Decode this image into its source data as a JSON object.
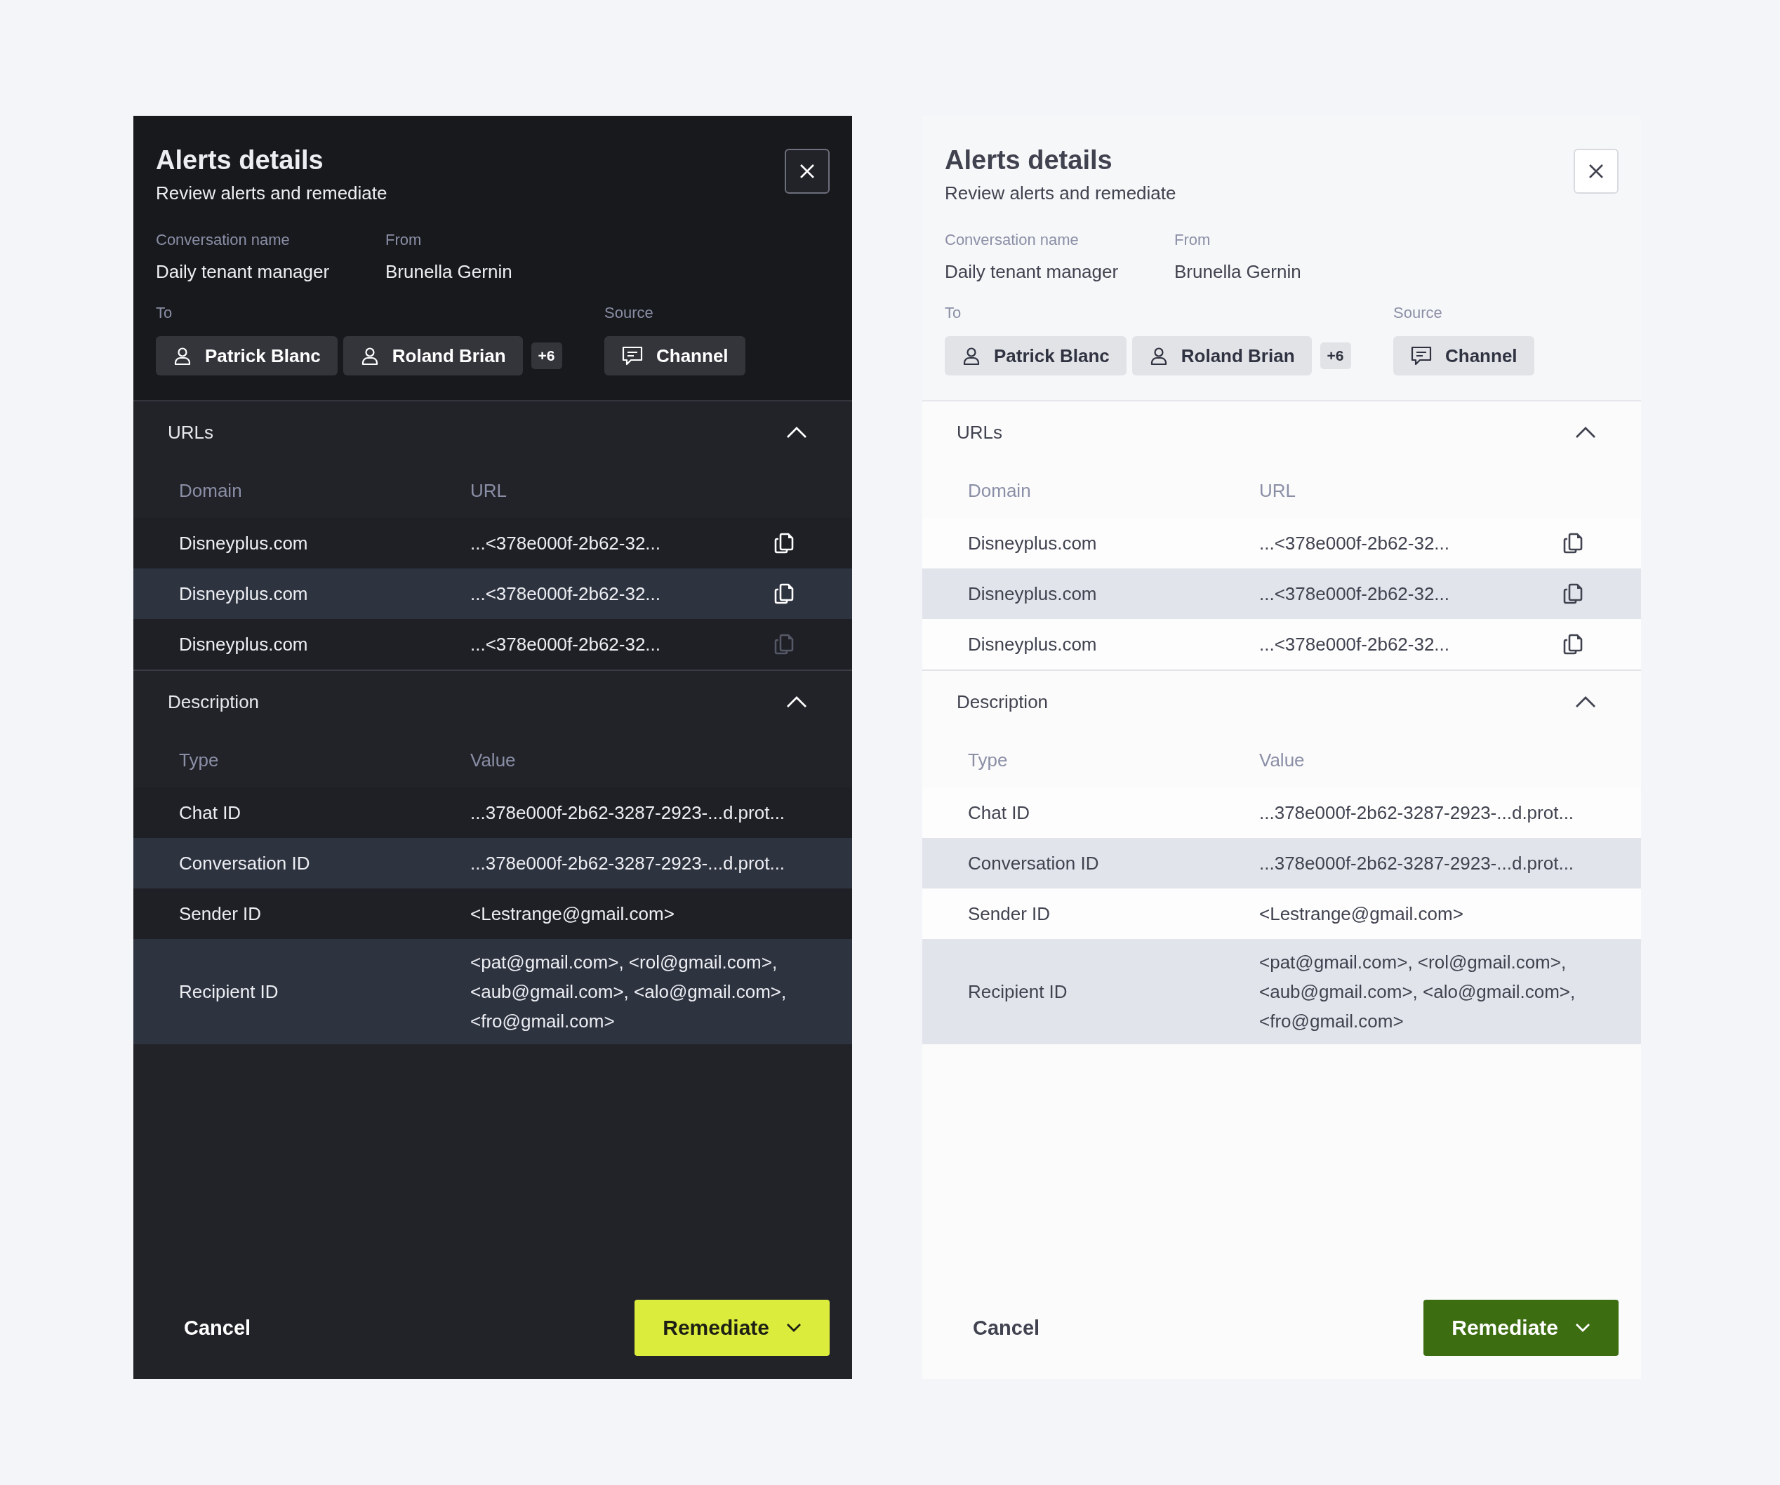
{
  "panels": [
    {
      "kind": "dark",
      "title": "Alerts details",
      "subtitle": "Review alerts and remediate",
      "fields": [
        {
          "label": "Conversation name",
          "value": "Daily tenant manager"
        },
        {
          "label": "From",
          "value": "Brunella Gernin"
        }
      ],
      "to": {
        "label": "To",
        "recipients": [
          "Patrick Blanc",
          "Roland Brian"
        ],
        "more": "+6"
      },
      "source": {
        "label": "Source",
        "value": "Channel"
      },
      "urls": {
        "title": "URLs",
        "expanded": true,
        "columns": [
          "Domain",
          "URL"
        ],
        "rows": [
          {
            "domain": "Disneyplus.com",
            "url": "...<378e000f-2b62-32...",
            "highlighted": false,
            "copy_disabled": false
          },
          {
            "domain": "Disneyplus.com",
            "url": "...<378e000f-2b62-32...",
            "highlighted": true,
            "copy_disabled": false
          },
          {
            "domain": "Disneyplus.com",
            "url": "...<378e000f-2b62-32...",
            "highlighted": false,
            "copy_disabled": true
          }
        ]
      },
      "description": {
        "title": "Description",
        "expanded": true,
        "columns": [
          "Type",
          "Value"
        ],
        "rows": [
          {
            "type": "Chat ID",
            "value": "...378e000f-2b62-3287-2923-...d.prot...",
            "highlighted": false
          },
          {
            "type": "Conversation ID",
            "value": "...378e000f-2b62-3287-2923-...d.prot...",
            "highlighted": true
          },
          {
            "type": "Sender ID",
            "value": "<Lestrange@gmail.com>",
            "highlighted": false
          },
          {
            "type": "Recipient ID",
            "value": "<pat@gmail.com>, <rol@gmail.com>, <aub@gmail.com>, <alo@gmail.com>, <fro@gmail.com>",
            "highlighted": true
          }
        ]
      },
      "cancel": "Cancel",
      "remediate": "Remediate"
    },
    {
      "kind": "light",
      "title": "Alerts details",
      "subtitle": "Review alerts and remediate",
      "fields": [
        {
          "label": "Conversation name",
          "value": "Daily tenant manager"
        },
        {
          "label": "From",
          "value": "Brunella Gernin"
        }
      ],
      "to": {
        "label": "To",
        "recipients": [
          "Patrick Blanc",
          "Roland Brian"
        ],
        "more": "+6"
      },
      "source": {
        "label": "Source",
        "value": "Channel"
      },
      "urls": {
        "title": "URLs",
        "expanded": true,
        "columns": [
          "Domain",
          "URL"
        ],
        "rows": [
          {
            "domain": "Disneyplus.com",
            "url": "...<378e000f-2b62-32...",
            "highlighted": false,
            "copy_disabled": false
          },
          {
            "domain": "Disneyplus.com",
            "url": "...<378e000f-2b62-32...",
            "highlighted": true,
            "copy_disabled": false
          },
          {
            "domain": "Disneyplus.com",
            "url": "...<378e000f-2b62-32...",
            "highlighted": false,
            "copy_disabled": false
          }
        ]
      },
      "description": {
        "title": "Description",
        "expanded": true,
        "columns": [
          "Type",
          "Value"
        ],
        "rows": [
          {
            "type": "Chat ID",
            "value": "...378e000f-2b62-3287-2923-...d.prot...",
            "highlighted": false
          },
          {
            "type": "Conversation ID",
            "value": "...378e000f-2b62-3287-2923-...d.prot...",
            "highlighted": true
          },
          {
            "type": "Sender ID",
            "value": "<Lestrange@gmail.com>",
            "highlighted": false
          },
          {
            "type": "Recipient ID",
            "value": "<pat@gmail.com>, <rol@gmail.com>, <aub@gmail.com>, <alo@gmail.com>, <fro@gmail.com>",
            "highlighted": true
          }
        ]
      },
      "cancel": "Cancel",
      "remediate": "Remediate"
    }
  ]
}
